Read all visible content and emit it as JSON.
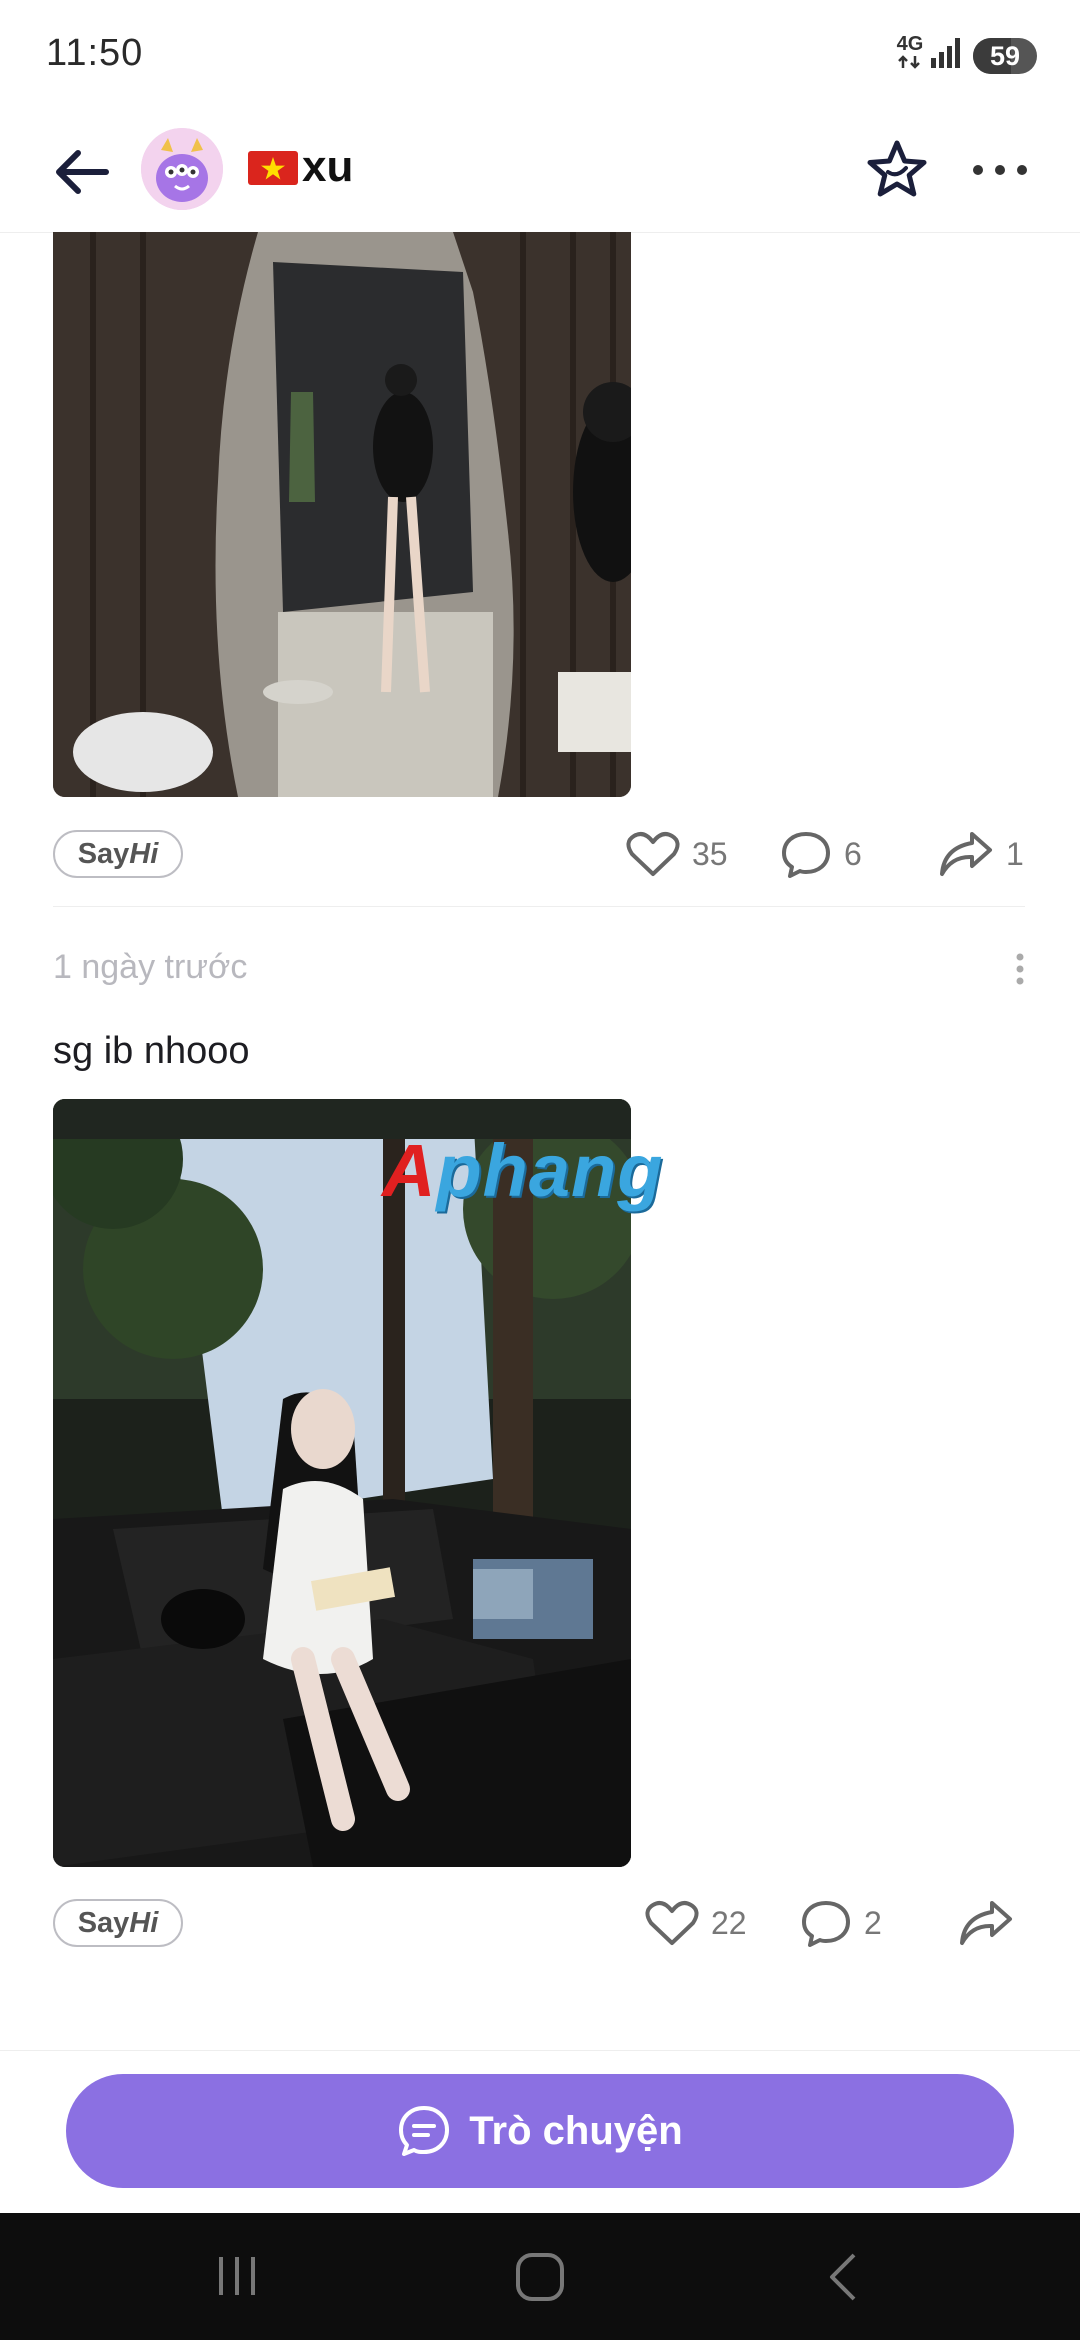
{
  "status_bar": {
    "time": "11:50",
    "network": "4G",
    "battery": "59"
  },
  "header": {
    "flag": "vn-flag",
    "username": "xu"
  },
  "posts": [
    {
      "say_hi": {
        "say": "Say",
        "hi": "Hi"
      },
      "likes": "35",
      "comments": "6",
      "shares": "1"
    },
    {
      "time_ago": "1 ngày trước",
      "caption": "sg ib nhooo",
      "say_hi": {
        "say": "Say",
        "hi": "Hi"
      },
      "likes": "22",
      "comments": "2"
    }
  ],
  "watermark": {
    "first": "A",
    "rest": "phang"
  },
  "chat_button": {
    "label": "Trò chuyện"
  },
  "colors": {
    "accent": "#8b70e2",
    "text": "#1d1d22",
    "muted": "#b8b8be"
  },
  "icons": [
    "back-arrow-icon",
    "avatar-monster-icon",
    "star-icon",
    "more-horizontal-icon",
    "heart-icon",
    "comment-icon",
    "share-icon",
    "chat-bubble-icon",
    "recent-apps-icon",
    "home-icon",
    "nav-back-icon"
  ]
}
